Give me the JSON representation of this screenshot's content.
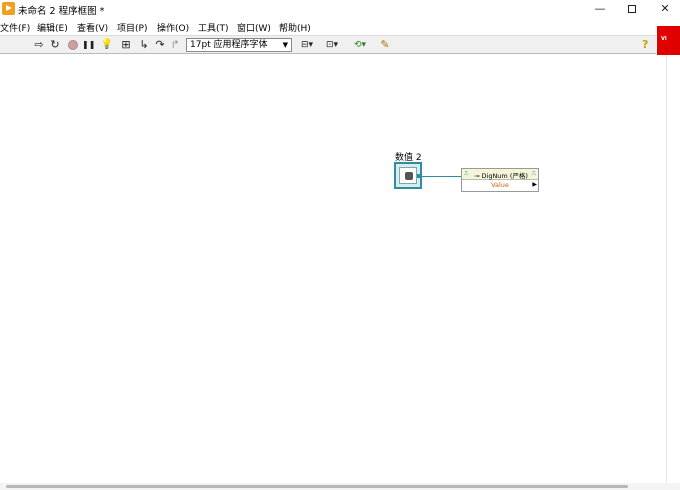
{
  "window": {
    "title": "未命名 2 程序框图 *",
    "controls": {
      "minimize": "—",
      "close": "✕"
    }
  },
  "menu": {
    "items": [
      "文件(F)",
      "编辑(E)",
      "查看(V)",
      "项目(P)",
      "操作(O)",
      "工具(T)",
      "窗口(W)",
      "帮助(H)"
    ]
  },
  "toolbar": {
    "run_glyph": "⇨",
    "run_continuous_glyph": "↻",
    "pause_glyph": "❚❚",
    "highlight_glyph": "💡",
    "retain_glyph": "⊞",
    "step_into_glyph": "↳",
    "step_over_glyph": "↷",
    "step_out_glyph": "↱",
    "font_select": "17pt 应用程序字体",
    "font_arrow": "▼",
    "align_glyph": "⊟▾",
    "distribute_glyph": "⊡▾",
    "reorder_glyph": "⟲▾",
    "cleanup_glyph": "✎",
    "help_glyph": "?"
  },
  "vi_icon": {
    "label": "VI"
  },
  "diagram": {
    "terminal_label": "数值 2",
    "property_node": {
      "ref_in": "⎍",
      "ref_out": "⎍",
      "class_name": "⊸ DigNum (严格)",
      "property": "Value",
      "arrow": "▶"
    }
  }
}
